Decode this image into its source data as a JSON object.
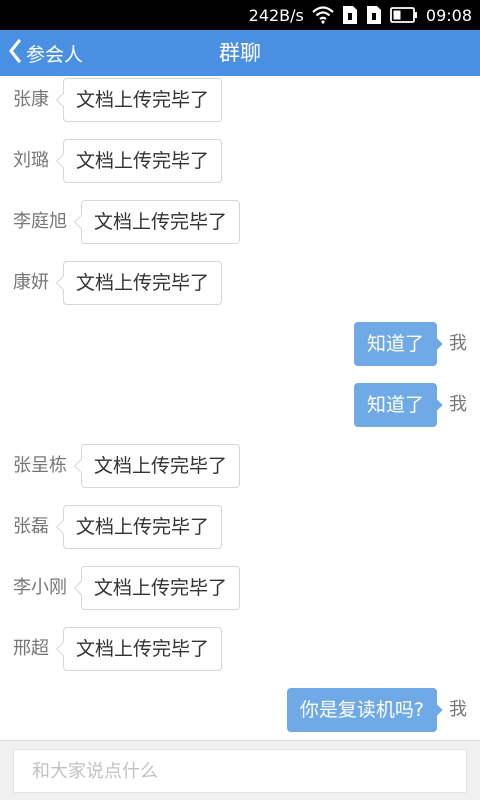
{
  "status_bar": {
    "speed": "242B/s",
    "time": "09:08",
    "icons": [
      "wifi-icon",
      "sim-card-icon",
      "sim-card-icon",
      "battery-icon"
    ]
  },
  "header": {
    "back_label": "参会人",
    "title": "群聊",
    "color": "#4a90e2"
  },
  "messages": [
    {
      "sender": "张康",
      "text": "文档上传完毕了",
      "outgoing": false
    },
    {
      "sender": "刘璐",
      "text": "文档上传完毕了",
      "outgoing": false
    },
    {
      "sender": "李庭旭",
      "text": "文档上传完毕了",
      "outgoing": false
    },
    {
      "sender": "康妍",
      "text": "文档上传完毕了",
      "outgoing": false
    },
    {
      "sender": "我",
      "text": "知道了",
      "outgoing": true
    },
    {
      "sender": "我",
      "text": "知道了",
      "outgoing": true
    },
    {
      "sender": "张呈栋",
      "text": "文档上传完毕了",
      "outgoing": false
    },
    {
      "sender": "张磊",
      "text": "文档上传完毕了",
      "outgoing": false
    },
    {
      "sender": "李小刚",
      "text": "文档上传完毕了",
      "outgoing": false
    },
    {
      "sender": "邢超",
      "text": "文档上传完毕了",
      "outgoing": false
    },
    {
      "sender": "我",
      "text": "你是复读机吗?",
      "outgoing": true
    }
  ],
  "composer": {
    "placeholder": "和大家说点什么",
    "value": ""
  },
  "colors": {
    "outgoing_bubble": "#6fa9e6",
    "incoming_border": "#d6d6d6"
  }
}
